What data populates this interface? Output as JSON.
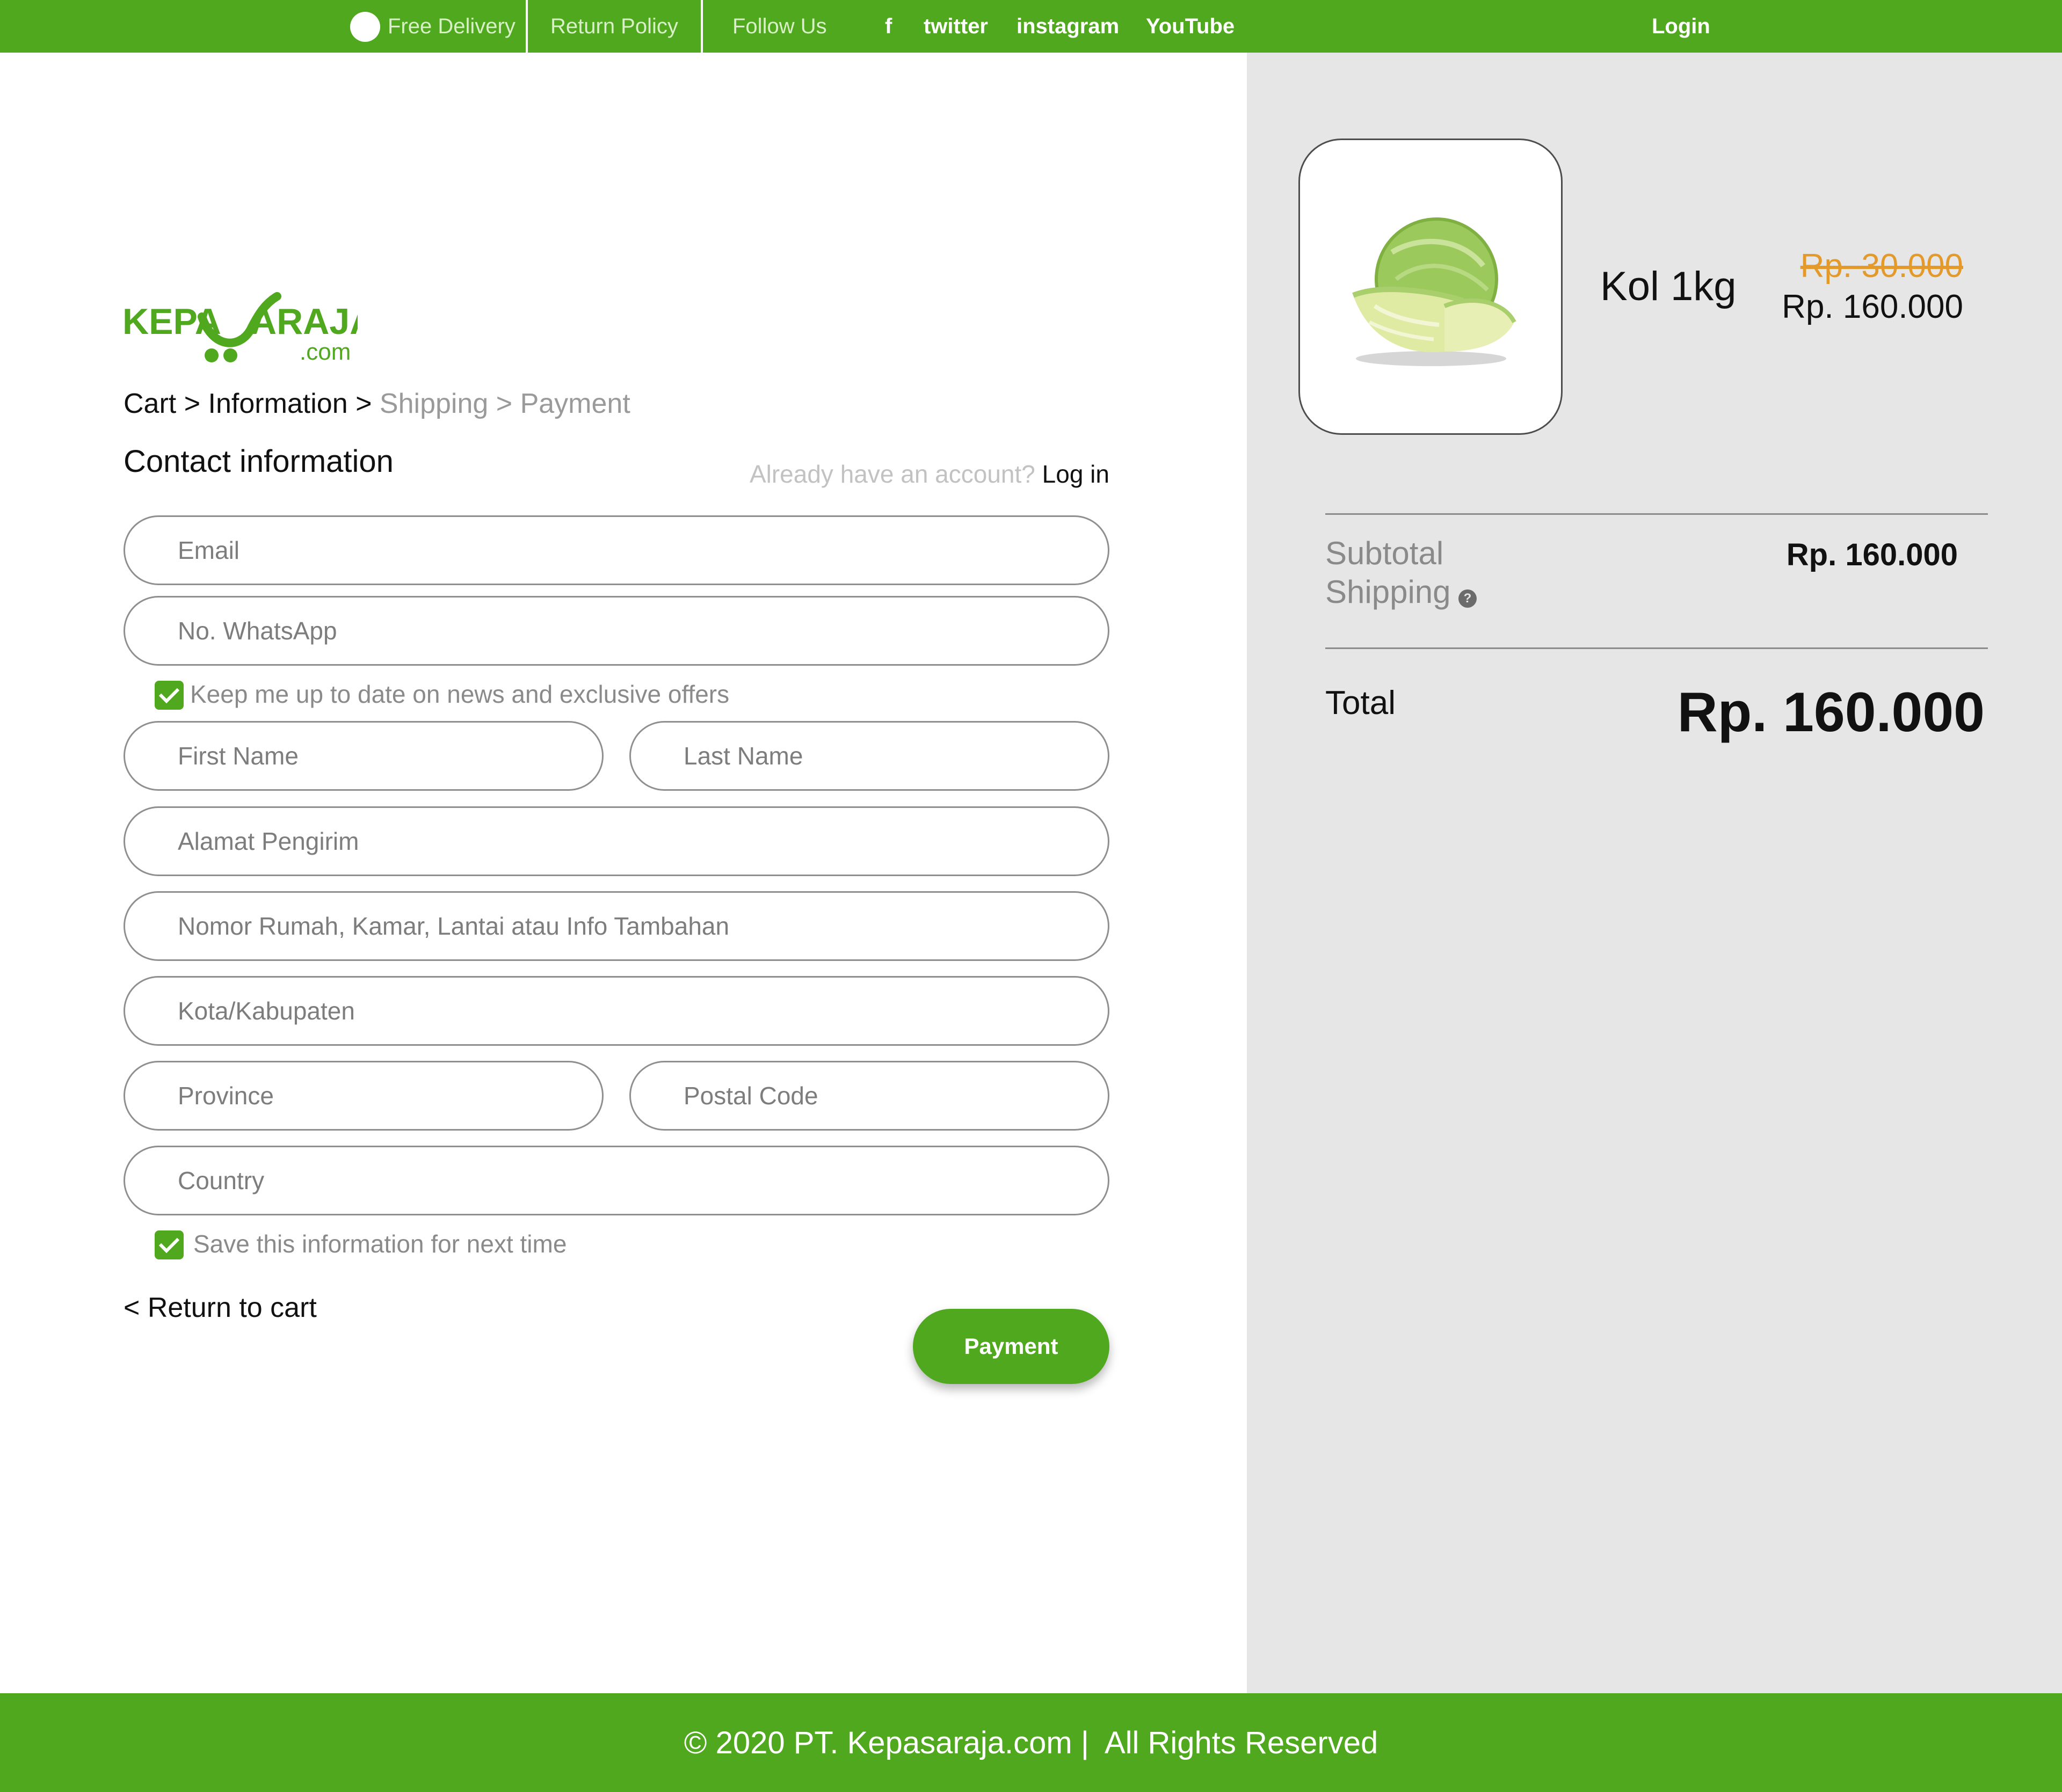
{
  "colors": {
    "brand_green": "#4fa81e",
    "panel_gray": "#e6e6e6",
    "old_price_orange": "#e39a2b"
  },
  "topbar": {
    "free_delivery": "Free Delivery",
    "return_policy": "Return Policy",
    "follow_us": "Follow Us",
    "facebook": "f",
    "twitter": "twitter",
    "instagram": "instagram",
    "youtube": "YouTube",
    "login": "Login"
  },
  "logo": {
    "name_left": "KEPA",
    "name_right": "ARAJA",
    "domain": ".com"
  },
  "breadcrumb": {
    "cart": "Cart",
    "sep1": " > ",
    "information": "Information",
    "sep2": " > ",
    "shipping": "Shipping",
    "sep3": " > ",
    "payment": "Payment"
  },
  "contact": {
    "title": "Contact information",
    "account_question": "Already have an account?",
    "login_link": "Log in"
  },
  "form": {
    "email_placeholder": "Email",
    "whatsapp_placeholder": "No. WhatsApp",
    "newsletter_label": "Keep me up to date on news and exclusive offers",
    "newsletter_checked": true,
    "first_name_placeholder": "First Name",
    "last_name_placeholder": "Last Name",
    "address_placeholder": "Alamat Pengirim",
    "address_extra_placeholder": "Nomor Rumah, Kamar, Lantai atau Info Tambahan",
    "city_placeholder": "Kota/Kabupaten",
    "province_placeholder": "Province",
    "postal_placeholder": "Postal Code",
    "country_placeholder": "Country",
    "save_label": "Save this information for next time",
    "save_checked": true,
    "return_link": "< Return to cart",
    "payment_button": "Payment"
  },
  "summary": {
    "product": {
      "name": "Kol 1kg",
      "image_icon": "cabbage-image",
      "old_price": "Rp. 30.000",
      "price": "Rp. 160.000"
    },
    "subtotal_label": "Subtotal",
    "subtotal_value": "Rp. 160.000",
    "shipping_label": "Shipping",
    "help_glyph": "?",
    "total_label": "Total",
    "total_value": "Rp. 160.000"
  },
  "footer": {
    "text": "© 2020 PT. Kepasaraja.com |  All Rights Reserved"
  }
}
